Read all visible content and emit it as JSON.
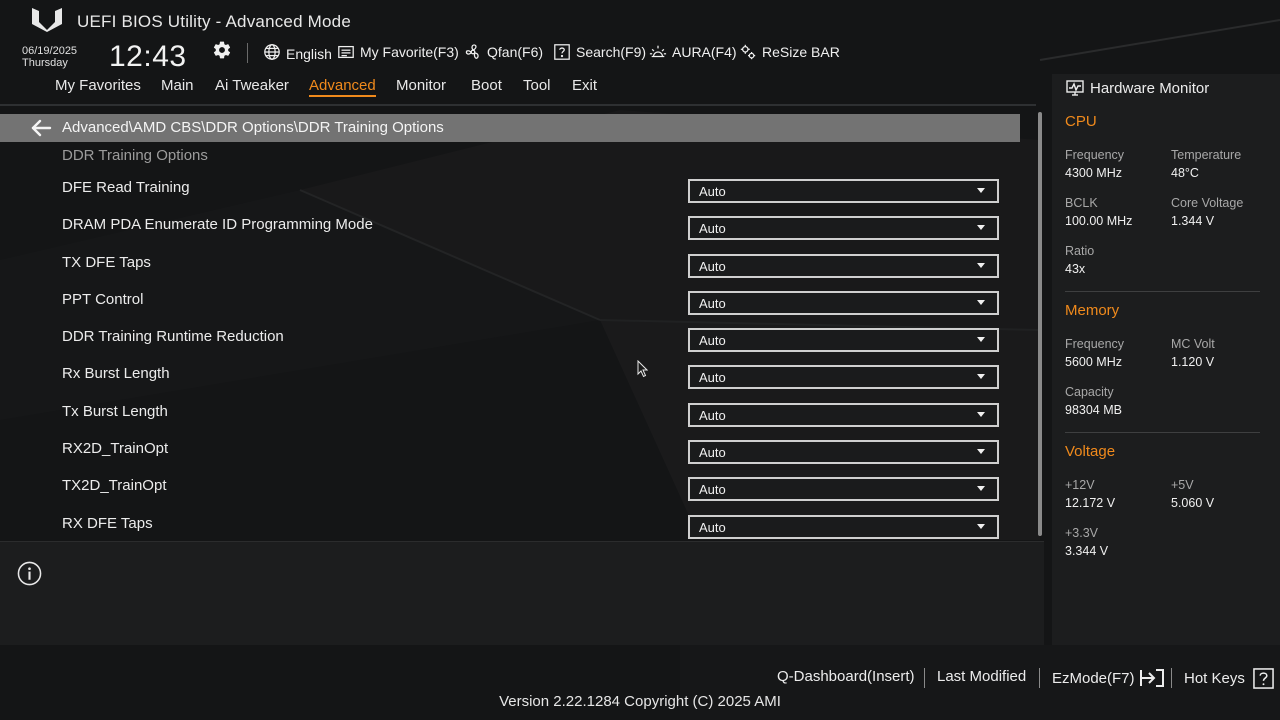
{
  "app": {
    "title": "UEFI BIOS Utility - Advanced Mode",
    "date": "06/19/2025",
    "weekday": "Thursday",
    "time": "12:43"
  },
  "toolbar": {
    "language": "English",
    "favorites": "My Favorite(F3)",
    "qfan": "Qfan(F6)",
    "search": "Search(F9)",
    "aura": "AURA(F4)",
    "resize_bar": "ReSize BAR",
    "icons": [
      "gear-icon",
      "globe-icon",
      "favorites-icon",
      "fan-icon",
      "search-icon",
      "aura-icon",
      "resize-bar-icon"
    ]
  },
  "nav": {
    "tabs": [
      "My Favorites",
      "Main",
      "Ai Tweaker",
      "Advanced",
      "Monitor",
      "Boot",
      "Tool",
      "Exit"
    ],
    "active": "Advanced"
  },
  "main": {
    "breadcrumb": "Advanced\\AMD CBS\\DDR Options\\DDR Training Options",
    "section_header": "DDR Training Options",
    "settings": [
      {
        "label": "DFE Read Training",
        "value": "Auto"
      },
      {
        "label": "DRAM PDA Enumerate ID Programming Mode",
        "value": "Auto"
      },
      {
        "label": "TX DFE Taps",
        "value": "Auto"
      },
      {
        "label": "PPT Control",
        "value": "Auto"
      },
      {
        "label": "DDR Training Runtime Reduction",
        "value": "Auto"
      },
      {
        "label": "Rx Burst Length",
        "value": "Auto"
      },
      {
        "label": "Tx Burst Length",
        "value": "Auto"
      },
      {
        "label": "RX2D_TrainOpt",
        "value": "Auto"
      },
      {
        "label": "TX2D_TrainOpt",
        "value": "Auto"
      },
      {
        "label": "RX DFE Taps",
        "value": "Auto"
      }
    ]
  },
  "hardware_monitor": {
    "title": "Hardware Monitor",
    "cpu": {
      "heading": "CPU",
      "frequency_label": "Frequency",
      "frequency": "4300 MHz",
      "temperature_label": "Temperature",
      "temperature": "48°C",
      "bclk_label": "BCLK",
      "bclk": "100.00 MHz",
      "core_voltage_label": "Core Voltage",
      "core_voltage": "1.344 V",
      "ratio_label": "Ratio",
      "ratio": "43x"
    },
    "memory": {
      "heading": "Memory",
      "frequency_label": "Frequency",
      "frequency": "5600 MHz",
      "mc_volt_label": "MC Volt",
      "mc_volt": "1.120 V",
      "capacity_label": "Capacity",
      "capacity": "98304 MB"
    },
    "voltage": {
      "heading": "Voltage",
      "v12_label": "+12V",
      "v12": "12.172 V",
      "v5_label": "+5V",
      "v5": "5.060 V",
      "v33_label": "+3.3V",
      "v33": "3.344 V"
    }
  },
  "footer": {
    "q_dashboard": "Q-Dashboard(Insert)",
    "last_modified": "Last Modified",
    "ez_mode": "EzMode(F7)",
    "hot_keys": "Hot Keys",
    "version": "Version 2.22.1284 Copyright (C) 2025 AMI"
  },
  "colors": {
    "accent": "#f08a1c",
    "background": "#141516",
    "panel": "#1c1d1e",
    "breadcrumb_bar": "#737373"
  }
}
